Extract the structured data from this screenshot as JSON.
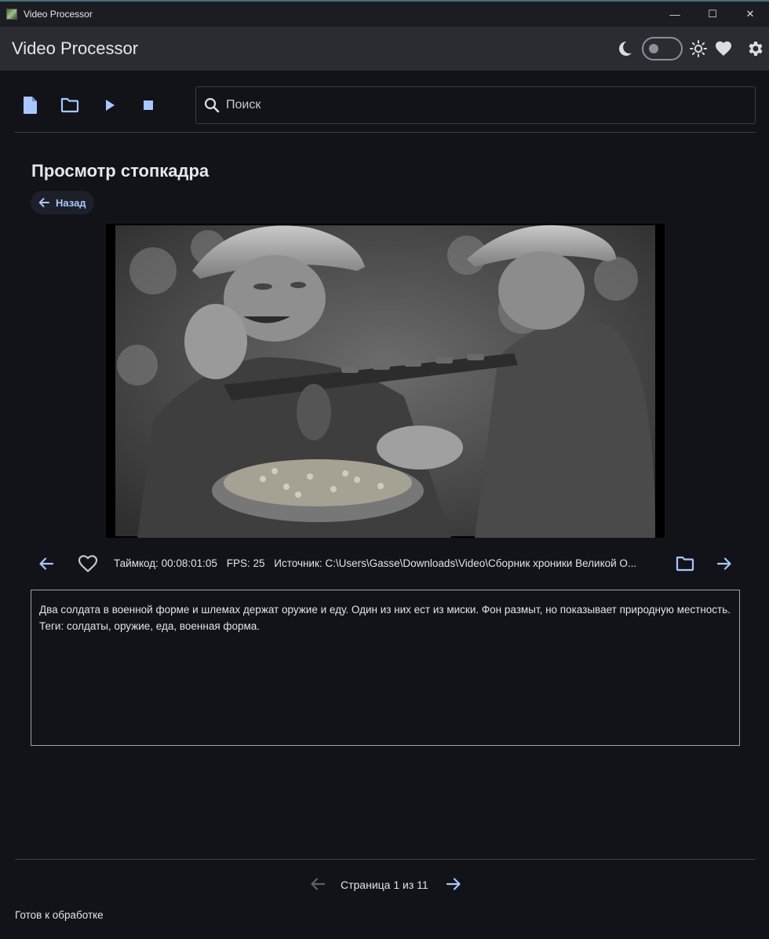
{
  "window": {
    "title": "Video Processor",
    "minimize_glyph": "—",
    "maximize_glyph": "☐",
    "close_glyph": "✕"
  },
  "header": {
    "title": "Video Processor",
    "theme_toggle_on": false
  },
  "toolbar": {
    "icons": [
      "file-icon",
      "folder-icon",
      "play-icon",
      "stop-icon"
    ],
    "search_placeholder": "Поиск",
    "search_value": ""
  },
  "main": {
    "title": "Просмотр стопкадра",
    "back_label": "Назад",
    "timecode": "Таймкод: 00:08:01:05",
    "fps": "FPS: 25",
    "source": "Источник: C:\\Users\\Gasse\\Downloads\\Video\\Сборник хроники Великой О...",
    "description": "Два солдата в военной форме и шлемах держат оружие и еду. Один из них ест из миски. Фон размыт, но показывает природную местность. Теги: солдаты, оружие, еда, военная форма."
  },
  "pagination": {
    "label": "Страница 1 из 11",
    "current": 1,
    "total": 11
  },
  "status": {
    "text": "Готов к обработке"
  },
  "colors": {
    "accent": "#a9c7ff",
    "background": "#111318",
    "header": "#2a2c32",
    "disabled": "#5d6068"
  }
}
